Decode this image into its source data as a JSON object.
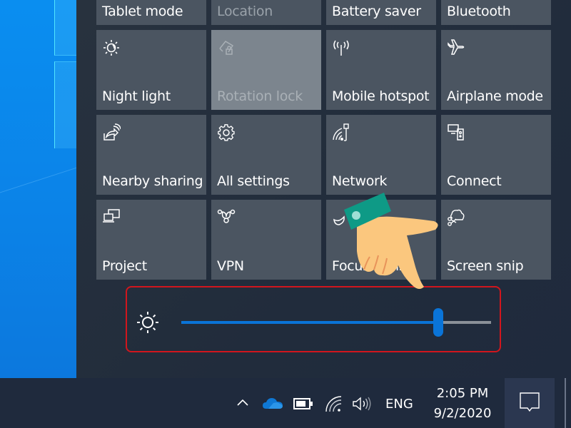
{
  "quick_actions": {
    "tiles": [
      {
        "label": "Tablet mode",
        "icon": "tablet-mode-icon",
        "state": "off"
      },
      {
        "label": "Location",
        "icon": "location-icon",
        "state": "disabled"
      },
      {
        "label": "Battery saver",
        "icon": "battery-saver-icon",
        "state": "off"
      },
      {
        "label": "Bluetooth",
        "icon": "bluetooth-icon",
        "state": "off"
      },
      {
        "label": "Night light",
        "icon": "night-light-icon",
        "state": "off"
      },
      {
        "label": "Rotation lock",
        "icon": "rotation-lock-icon",
        "state": "active-disabled"
      },
      {
        "label": "Mobile hotspot",
        "icon": "mobile-hotspot-icon",
        "state": "off"
      },
      {
        "label": "Airplane mode",
        "icon": "airplane-icon",
        "state": "off"
      },
      {
        "label": "Nearby sharing",
        "icon": "nearby-sharing-icon",
        "state": "off"
      },
      {
        "label": "All settings",
        "icon": "gear-icon",
        "state": "off"
      },
      {
        "label": "Network",
        "icon": "network-icon",
        "state": "off"
      },
      {
        "label": "Connect",
        "icon": "connect-icon",
        "state": "off"
      },
      {
        "label": "Project",
        "icon": "project-icon",
        "state": "off"
      },
      {
        "label": "VPN",
        "icon": "vpn-icon",
        "state": "off"
      },
      {
        "label": "Focus assist",
        "icon": "moon-icon",
        "state": "off"
      },
      {
        "label": "Screen snip",
        "icon": "screen-snip-icon",
        "state": "off"
      }
    ]
  },
  "brightness": {
    "icon": "brightness-sun-icon",
    "value_percent": 83,
    "highlight_color": "#d1161d",
    "accent_color": "#0a74d8"
  },
  "taskbar": {
    "tray_icons": [
      "chevron-up-icon",
      "onedrive-icon",
      "battery-icon",
      "wifi-icon",
      "volume-icon"
    ],
    "language": "ENG",
    "time": "2:05 PM",
    "date": "9/2/2020",
    "action_center_icon": "notification-icon"
  },
  "overlay": {
    "pointer": "pointing-hand-illustration"
  }
}
